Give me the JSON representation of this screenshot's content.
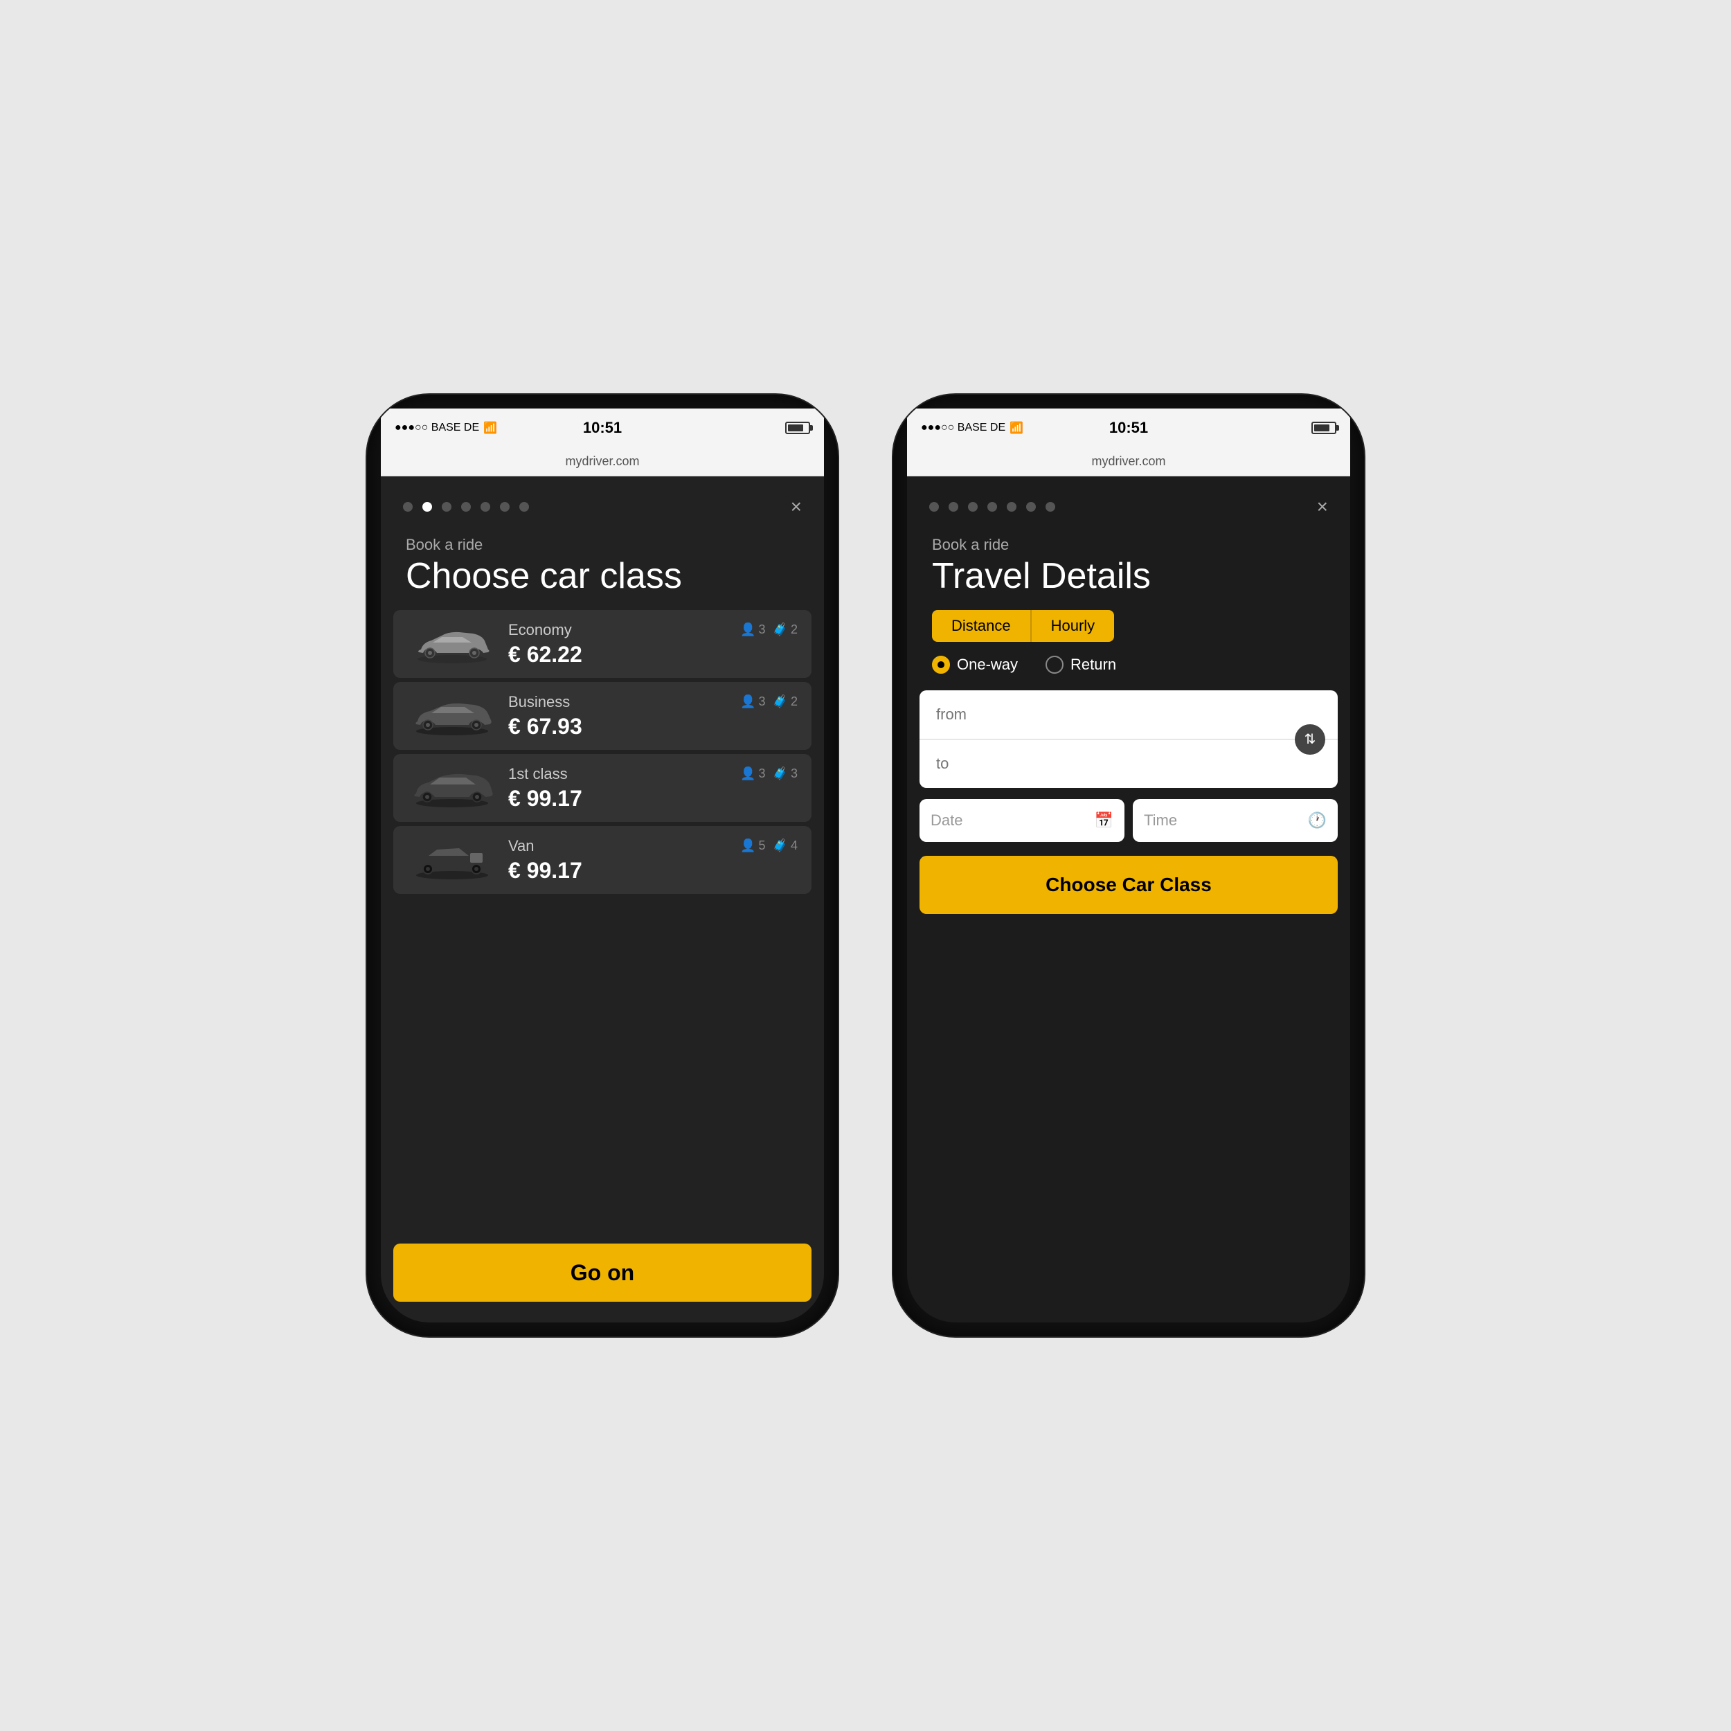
{
  "scene": {
    "bg_color": "#e8e8e8"
  },
  "phone_left": {
    "status_bar": {
      "carrier": "●●●○○ BASE DE",
      "wifi": "WiFi",
      "time": "10:51",
      "url": "mydriver.com"
    },
    "nav": {
      "dots": [
        false,
        true,
        false,
        false,
        false,
        false,
        false
      ],
      "close": "×"
    },
    "header": {
      "book_label": "Book a ride",
      "title": "Choose car class"
    },
    "cars": [
      {
        "name": "Economy",
        "passengers": "3",
        "luggage": "2",
        "price": "€ 62.22",
        "selected": false
      },
      {
        "name": "Business",
        "passengers": "3",
        "luggage": "2",
        "price": "€ 67.93",
        "selected": false
      },
      {
        "name": "1st class",
        "passengers": "3",
        "luggage": "3",
        "price": "€ 99.17",
        "selected": false
      },
      {
        "name": "Van",
        "passengers": "5",
        "luggage": "4",
        "price": "€ 99.17",
        "selected": false
      }
    ],
    "go_on_label": "Go on"
  },
  "phone_right": {
    "status_bar": {
      "carrier": "●●●○○ BASE DE",
      "wifi": "WiFi",
      "time": "10:51",
      "url": "mydriver.com"
    },
    "nav": {
      "dots": [
        false,
        false,
        false,
        false,
        false,
        false,
        false
      ],
      "close": "×"
    },
    "header": {
      "book_label": "Book a ride",
      "title": "Travel Details"
    },
    "tabs": {
      "distance_label": "Distance",
      "hourly_label": "Hourly",
      "active": "hourly"
    },
    "radio": {
      "oneway_label": "One-way",
      "return_label": "Return",
      "selected": "oneway"
    },
    "from_placeholder": "from",
    "to_placeholder": "to",
    "date_placeholder": "Date",
    "time_placeholder": "Time",
    "choose_car_label": "Choose Car Class"
  }
}
